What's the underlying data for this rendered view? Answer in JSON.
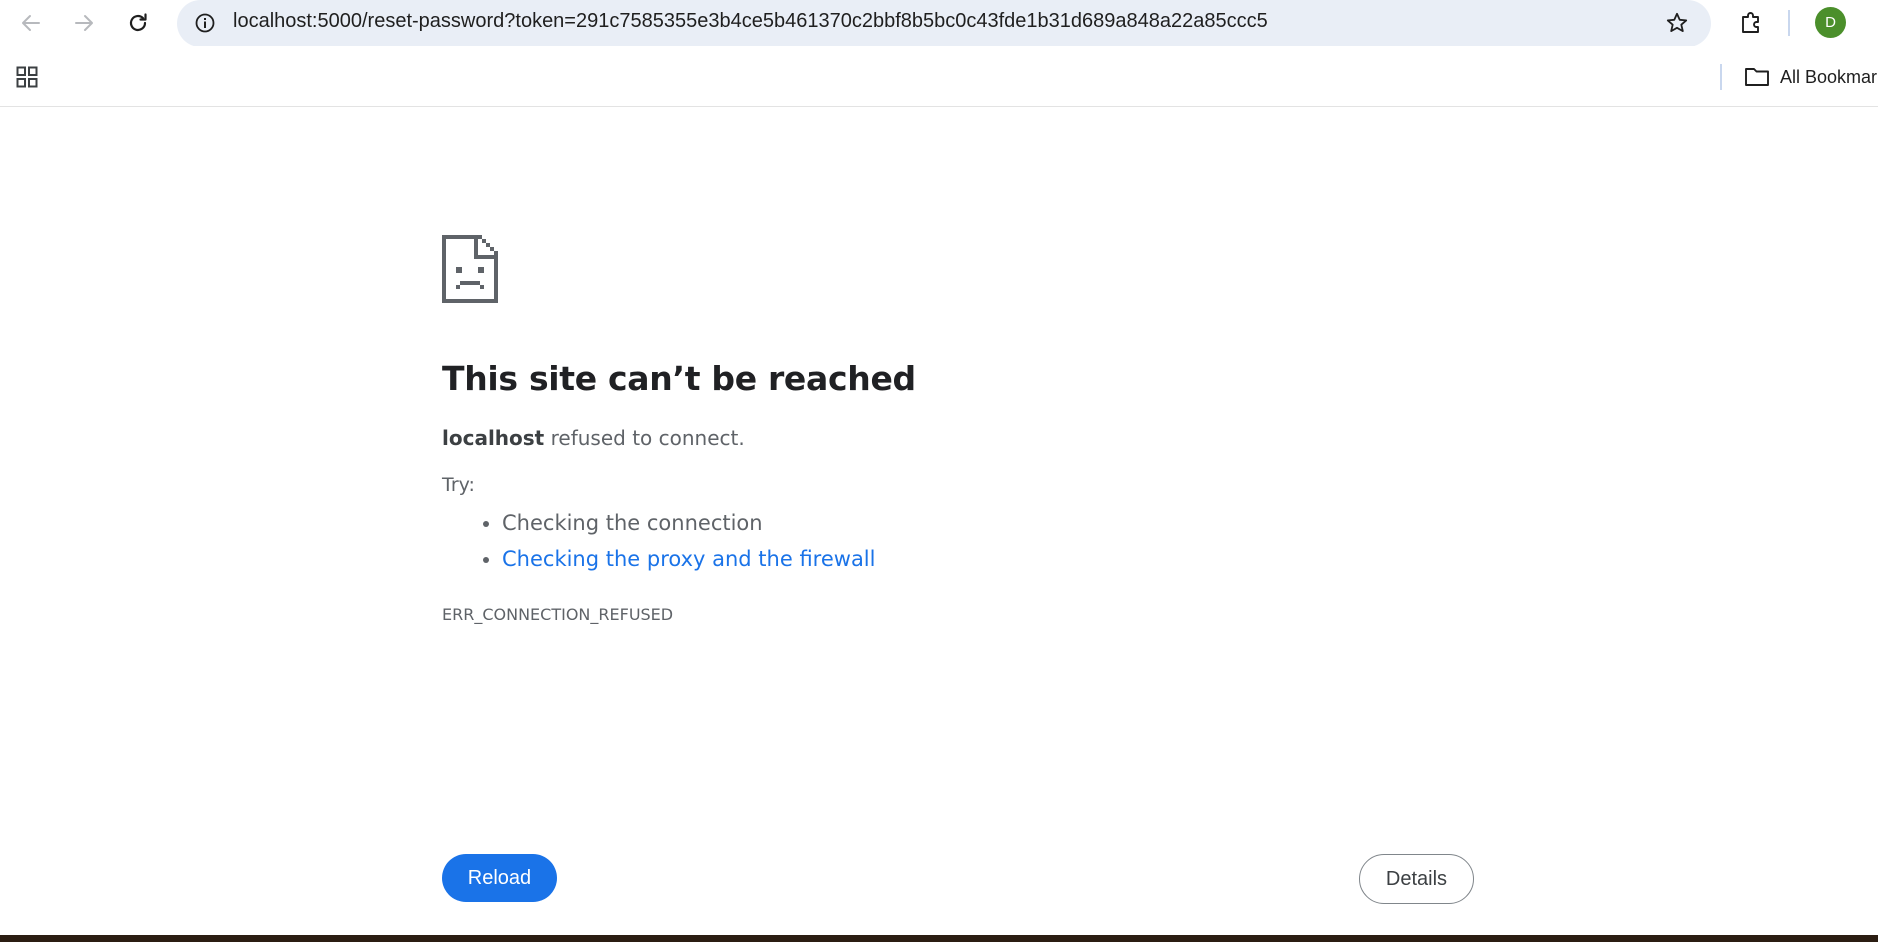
{
  "browser": {
    "url": "localhost:5000/reset-password?token=291c7585355e3b4ce5b461370c2bbf8b5bc0c43fde1b31d689a848a22a85ccc5",
    "profile_initial": "D",
    "profile_color": "#4b8f2b",
    "icons": {
      "back": "arrow-left-icon",
      "forward": "arrow-right-icon",
      "reload": "reload-icon",
      "site_info": "info-icon",
      "bookmark": "star-icon",
      "extensions": "puzzle-icon",
      "apps": "apps-grid-icon",
      "folder": "folder-icon"
    }
  },
  "bookmarks_bar": {
    "all_bookmarks_label": "All Bookmar"
  },
  "error_page": {
    "title": "This site can’t be reached",
    "host": "localhost",
    "description": " refused to connect.",
    "try_label": "Try:",
    "suggestions": [
      {
        "text": "Checking the connection",
        "is_link": false
      },
      {
        "text": "Checking the proxy and the firewall",
        "is_link": true
      }
    ],
    "error_code": "ERR_CONNECTION_REFUSED",
    "reload_label": "Reload",
    "details_label": "Details",
    "link_color": "#1a73e8",
    "button_color": "#1a73e8"
  }
}
